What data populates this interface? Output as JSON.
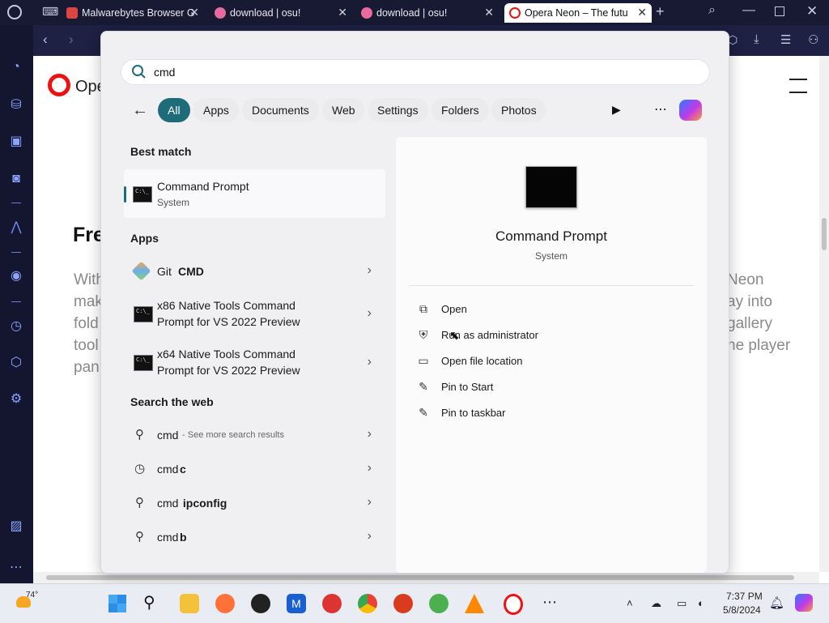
{
  "browser": {
    "tabs": [
      {
        "title": "Malwarebytes Browser G",
        "color": "#d44"
      },
      {
        "title": "download | osu!",
        "color": "#e86b9e"
      },
      {
        "title": "download | osu!",
        "color": "#e86b9e"
      },
      {
        "title": "Opera Neon – The futu",
        "color": "#e11"
      }
    ],
    "active_tab": 3
  },
  "page_bg": {
    "logo_text": "Ope",
    "heading": "Fre",
    "lines_left": [
      "With",
      "mak",
      "fold",
      "tool",
      "pan"
    ],
    "lines_right": [
      "Neon",
      "ay into",
      "gallery",
      "he player"
    ]
  },
  "search": {
    "query": "cmd",
    "filters": [
      "All",
      "Apps",
      "Documents",
      "Web",
      "Settings",
      "Folders",
      "Photos"
    ],
    "active_filter": "All"
  },
  "results": {
    "best_match_header": "Best match",
    "best_match": {
      "title": "Command Prompt",
      "subtitle": "System"
    },
    "apps_header": "Apps",
    "apps": [
      {
        "prefix": "Git ",
        "bold": "CMD",
        "line2": ""
      },
      {
        "line1": "x86 Native Tools Command",
        "line2": "Prompt for VS 2022 Preview"
      },
      {
        "line1": "x64 Native Tools Command",
        "line2": "Prompt for VS 2022 Preview"
      }
    ],
    "web_header": "Search the web",
    "web": [
      {
        "bold": "cmd",
        "rest": " - See more search results"
      },
      {
        "bold": "cmd",
        "rest": "c"
      },
      {
        "bold": "cmd",
        "rest": " ipconfig"
      },
      {
        "bold": "cmd",
        "rest": "b"
      }
    ]
  },
  "details": {
    "title": "Command Prompt",
    "subtitle": "System",
    "actions": [
      "Open",
      "Run as administrator",
      "Open file location",
      "Pin to Start",
      "Pin to taskbar"
    ]
  },
  "taskbar": {
    "weather": "74°",
    "time": "7:37 PM",
    "date": "5/8/2024"
  }
}
